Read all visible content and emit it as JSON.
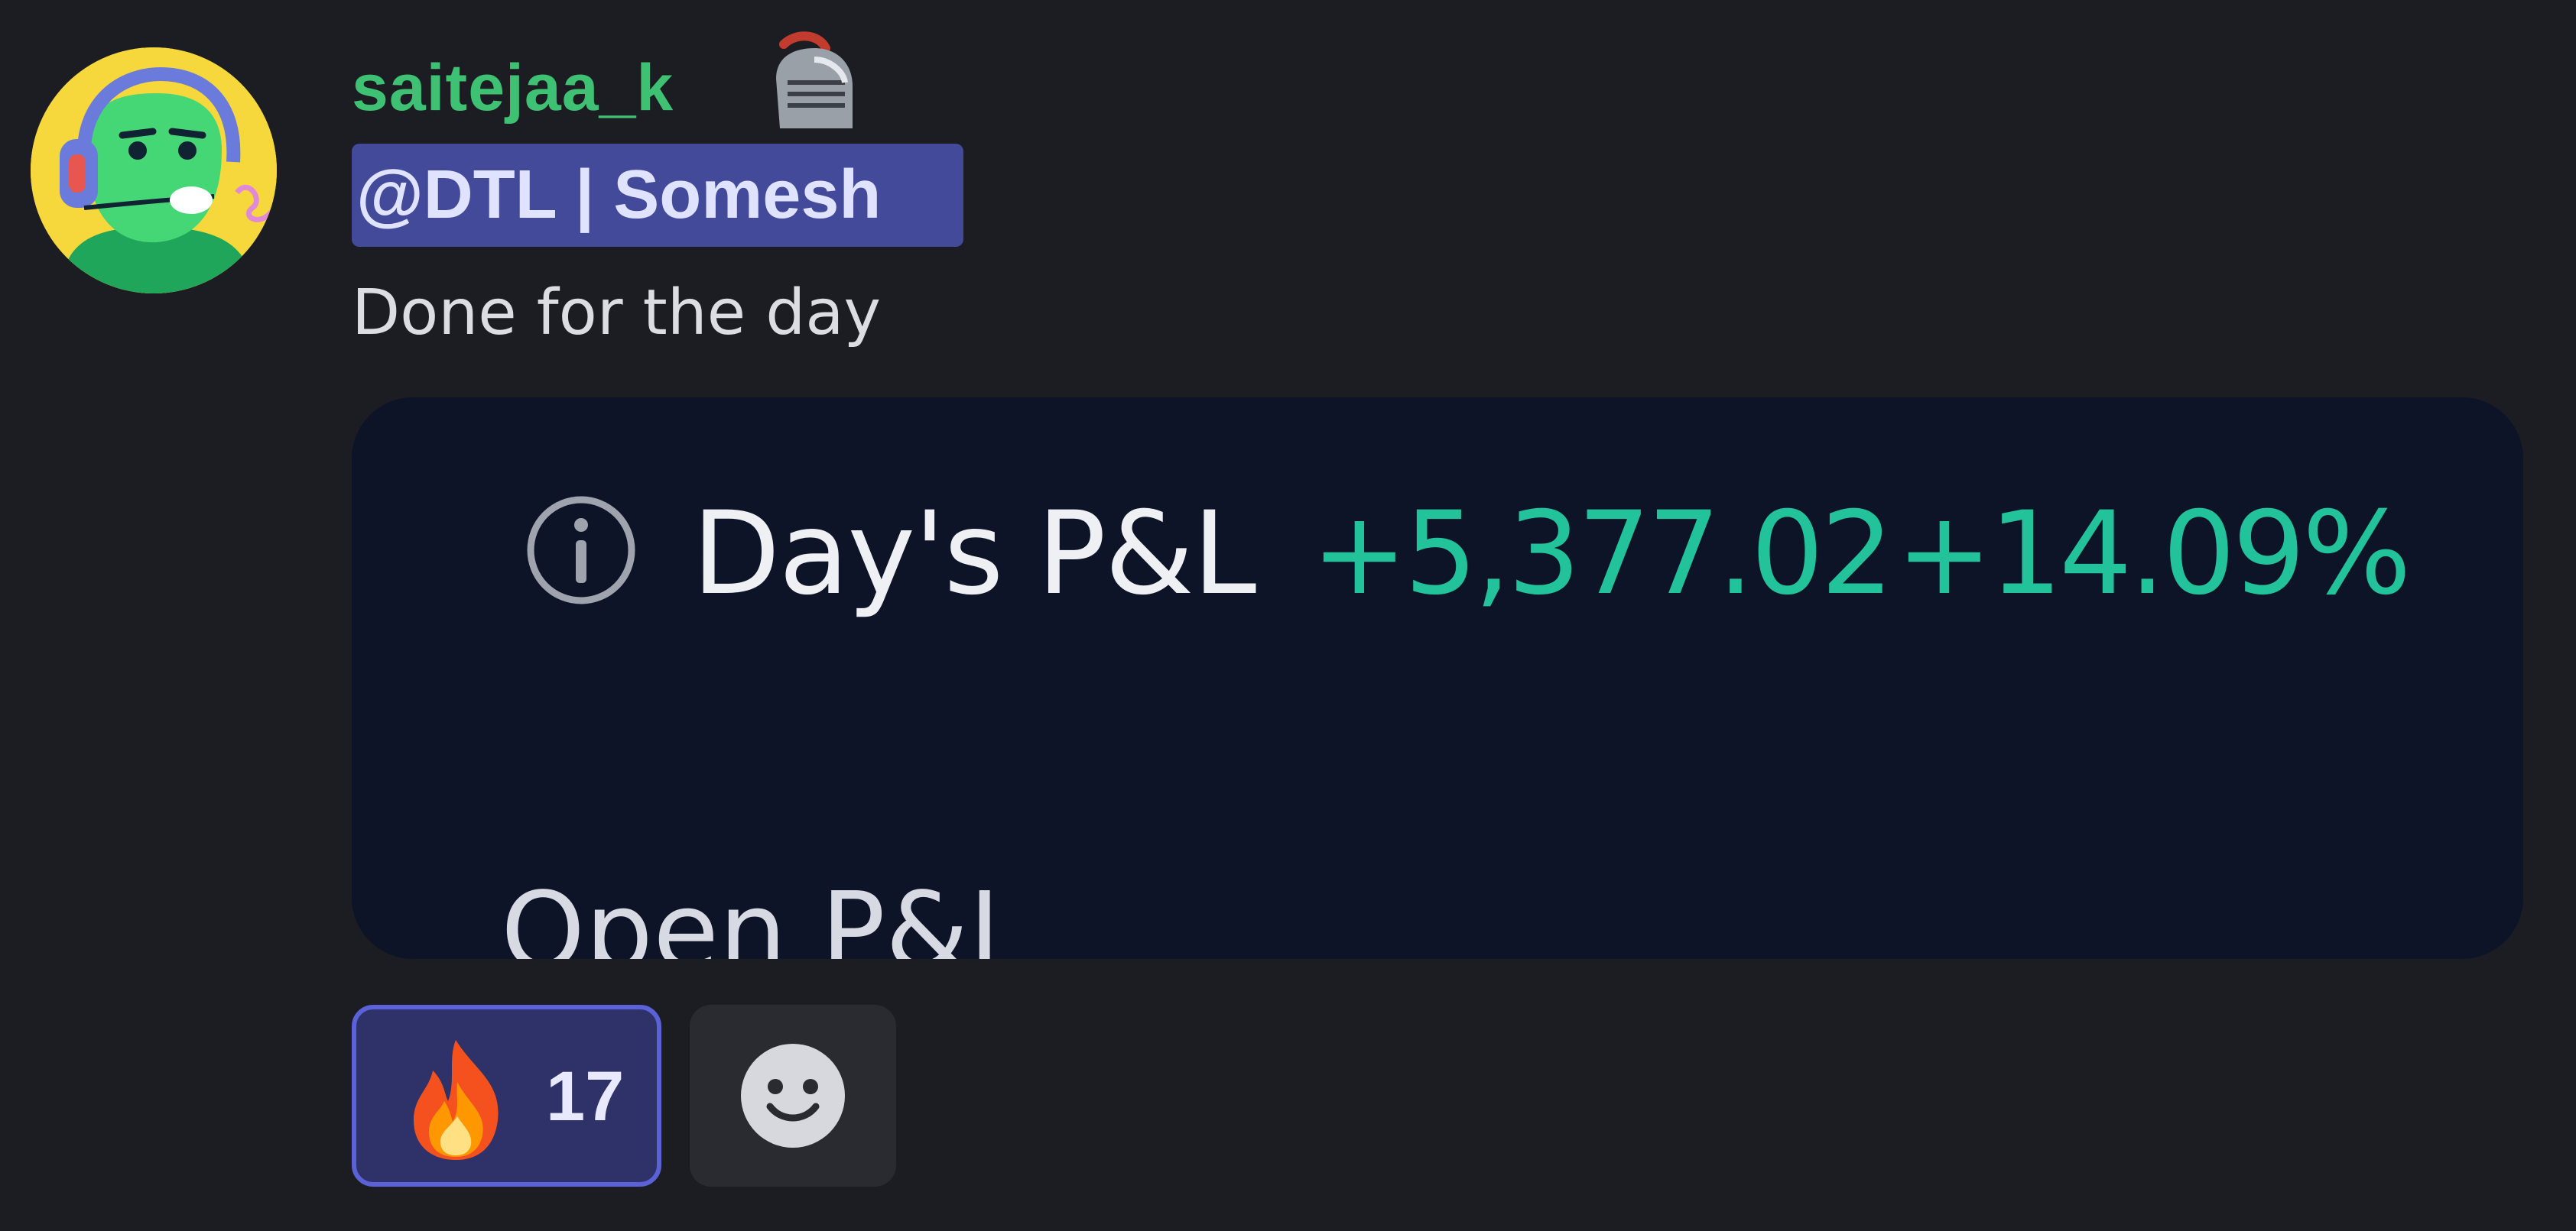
{
  "message": {
    "author": "saitejaa_k",
    "role_icon": "knight-helmet-icon",
    "mention": "@DTL | Somesh",
    "content": "Done for the day",
    "avatar_icon": "green-gamer-avatar-icon"
  },
  "embed": {
    "info_icon": "info-icon",
    "day_pnl_label": "Day's P&L",
    "day_pnl_value": "+5,377.02",
    "day_pnl_percent": "+14.09%",
    "open_pnl_label": "Open P&L"
  },
  "reactions": [
    {
      "emoji": "fire-icon",
      "count": "17"
    }
  ],
  "add_reaction_icon": "smiley-icon",
  "colors": {
    "background": "#1c1d22",
    "username": "#3fc173",
    "mention_bg": "#434a9a",
    "card_bg": "#0e1428",
    "profit": "#22c29a",
    "reaction_border": "#5b61d7"
  }
}
